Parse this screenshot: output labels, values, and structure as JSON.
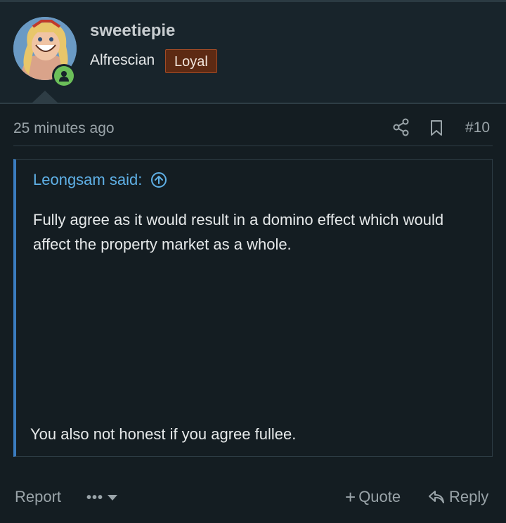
{
  "user": {
    "name": "sweetiepie",
    "title": "Alfrescian",
    "banner": "Loyal",
    "avatar_icon": "cartoon-avatar",
    "status": "online"
  },
  "post": {
    "time": "25 minutes ago",
    "number": "#10",
    "share_icon": "share-icon",
    "bookmark_icon": "bookmark-icon"
  },
  "quote": {
    "author": "Leongsam said:",
    "text": "Fully agree as it would result in a domino effect which would affect the property market as a whole."
  },
  "body": {
    "text": "You also not honest if you agree fullee."
  },
  "actions": {
    "report": "Report",
    "more": "•••",
    "quote": "Quote",
    "quote_prefix": "+",
    "reply": "Reply"
  },
  "colors": {
    "background": "#141d22",
    "header": "#18242b",
    "quote_accent": "#3a7cc0",
    "link": "#5fb0e6",
    "banner_bg": "#5d2a13",
    "online": "#6bbf59"
  }
}
